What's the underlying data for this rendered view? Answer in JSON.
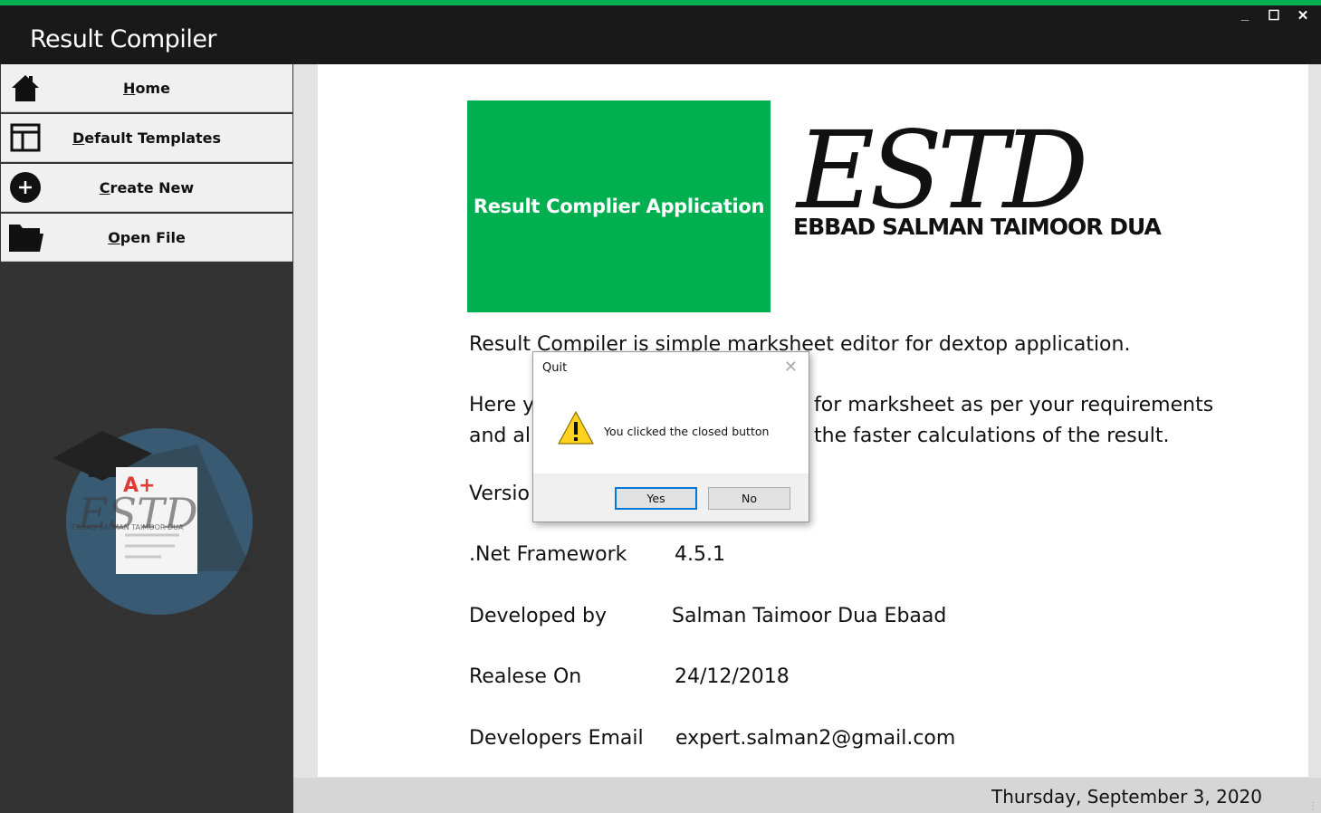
{
  "window": {
    "title": "Result Compiler",
    "controls": {
      "minimize": "_",
      "maximize": "☐",
      "close": "✕"
    }
  },
  "colors": {
    "accent": "#00b050",
    "titlebar": "#191919",
    "sidebar": "#333333"
  },
  "sidebar": {
    "items": [
      {
        "label": "Home",
        "icon": "home-icon"
      },
      {
        "label": "Default Templates",
        "icon": "templates-icon"
      },
      {
        "label": "Create New",
        "icon": "plus-circle-icon"
      },
      {
        "label": "Open File",
        "icon": "folder-icon"
      }
    ],
    "logo": {
      "grade": "A+",
      "brand": "ESTD",
      "brand_sub": "EBBAD SALMAN TAIMOOR DUA"
    }
  },
  "main": {
    "banner": "Result Complier Application",
    "logo_text": "ESTD",
    "logo_subtitle": "EBBAD SALMAN  TAIMOOR DUA",
    "description_line1": "Result Compiler is simple marksheet editor for dextop application.",
    "description_line2a": "Here y",
    "description_line2b": "for marksheet as per your requirements",
    "description_line3a": "and al",
    "description_line3b": "the faster calculations of the result.",
    "version_label": "Versio",
    "info": [
      {
        "label": ".Net Framework",
        "value": "4.5.1"
      },
      {
        "label": "Developed by",
        "value": "Salman Taimoor Dua Ebaad"
      },
      {
        "label": "Realese On",
        "value": "24/12/2018"
      },
      {
        "label": "Developers Email",
        "value": "expert.salman2@gmail.com"
      }
    ]
  },
  "status": {
    "date": "Thursday, September 3, 2020"
  },
  "dialog": {
    "title": "Quit",
    "icon": "warning-icon",
    "message": "You clicked the closed button",
    "yes": "Yes",
    "no": "No",
    "close": "✕"
  }
}
